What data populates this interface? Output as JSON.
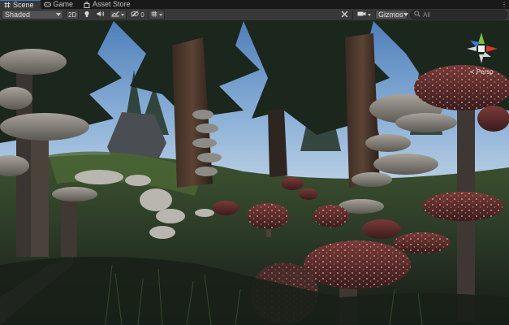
{
  "tabs": [
    {
      "label": "Scene",
      "icon": "hash-icon",
      "active": true
    },
    {
      "label": "Game",
      "icon": "gamepad-icon",
      "active": false
    },
    {
      "label": "Asset Store",
      "icon": "bag-icon",
      "active": false
    }
  ],
  "toolbar": {
    "render_mode": "Shaded",
    "toggle_2d": "2D",
    "hidden_count": "0",
    "gizmos_label": "Gizmos",
    "search_placeholder": "All"
  },
  "scene": {
    "projection_label": "Persp"
  },
  "colors": {
    "sky": "#7fa6d4",
    "accent_tab": "#3a79bb",
    "toolbar_bg": "#383838",
    "tabbar_bg": "#191919",
    "axis_x": "#d23a2a",
    "axis_y": "#7cc23a",
    "axis_z": "#3b7be0"
  }
}
